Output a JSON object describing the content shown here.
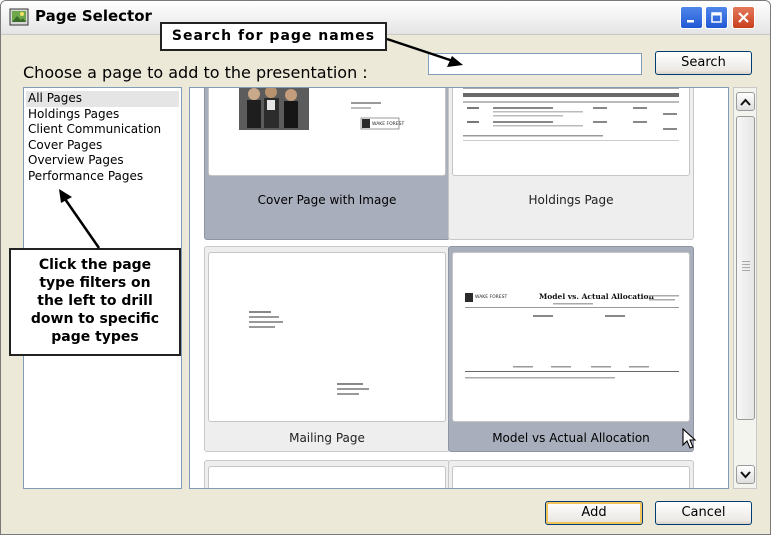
{
  "window": {
    "title": "Page Selector"
  },
  "header": {
    "choose_label": "Choose a page to add to the presentation :"
  },
  "search": {
    "value": "",
    "button_label": "Search"
  },
  "filters": [
    {
      "label": "All Pages",
      "selected": true
    },
    {
      "label": "Holdings Pages",
      "selected": false
    },
    {
      "label": "Client Communication",
      "selected": false
    },
    {
      "label": "Cover Pages",
      "selected": false
    },
    {
      "label": "Overview Pages",
      "selected": false
    },
    {
      "label": "Performance Pages",
      "selected": false
    }
  ],
  "tiles": [
    {
      "caption": "Cover Page with Image",
      "selected": true
    },
    {
      "caption": "Holdings Page",
      "selected": false
    },
    {
      "caption": "Mailing Page",
      "selected": false
    },
    {
      "caption": "Model vs Actual Allocation",
      "selected": true
    },
    {
      "caption": "",
      "selected": false
    },
    {
      "caption": "",
      "selected": false
    }
  ],
  "thumbs": {
    "cover_logo": "WAKE FOREST",
    "model_logo": "WAKE FOREST",
    "model_title": "Model vs. Actual Allocation"
  },
  "footer": {
    "add_label": "Add",
    "cancel_label": "Cancel"
  },
  "callouts": {
    "search": "Search for page names",
    "filters": [
      "Click the page",
      "type filters on",
      "the left to drill",
      "down to specific",
      "page types"
    ]
  },
  "colors": {
    "selected_tile": "#a8aebc",
    "add_focus": "#f2c35a",
    "close_button": "#c8401f",
    "title_buttons": "#2159d4"
  }
}
